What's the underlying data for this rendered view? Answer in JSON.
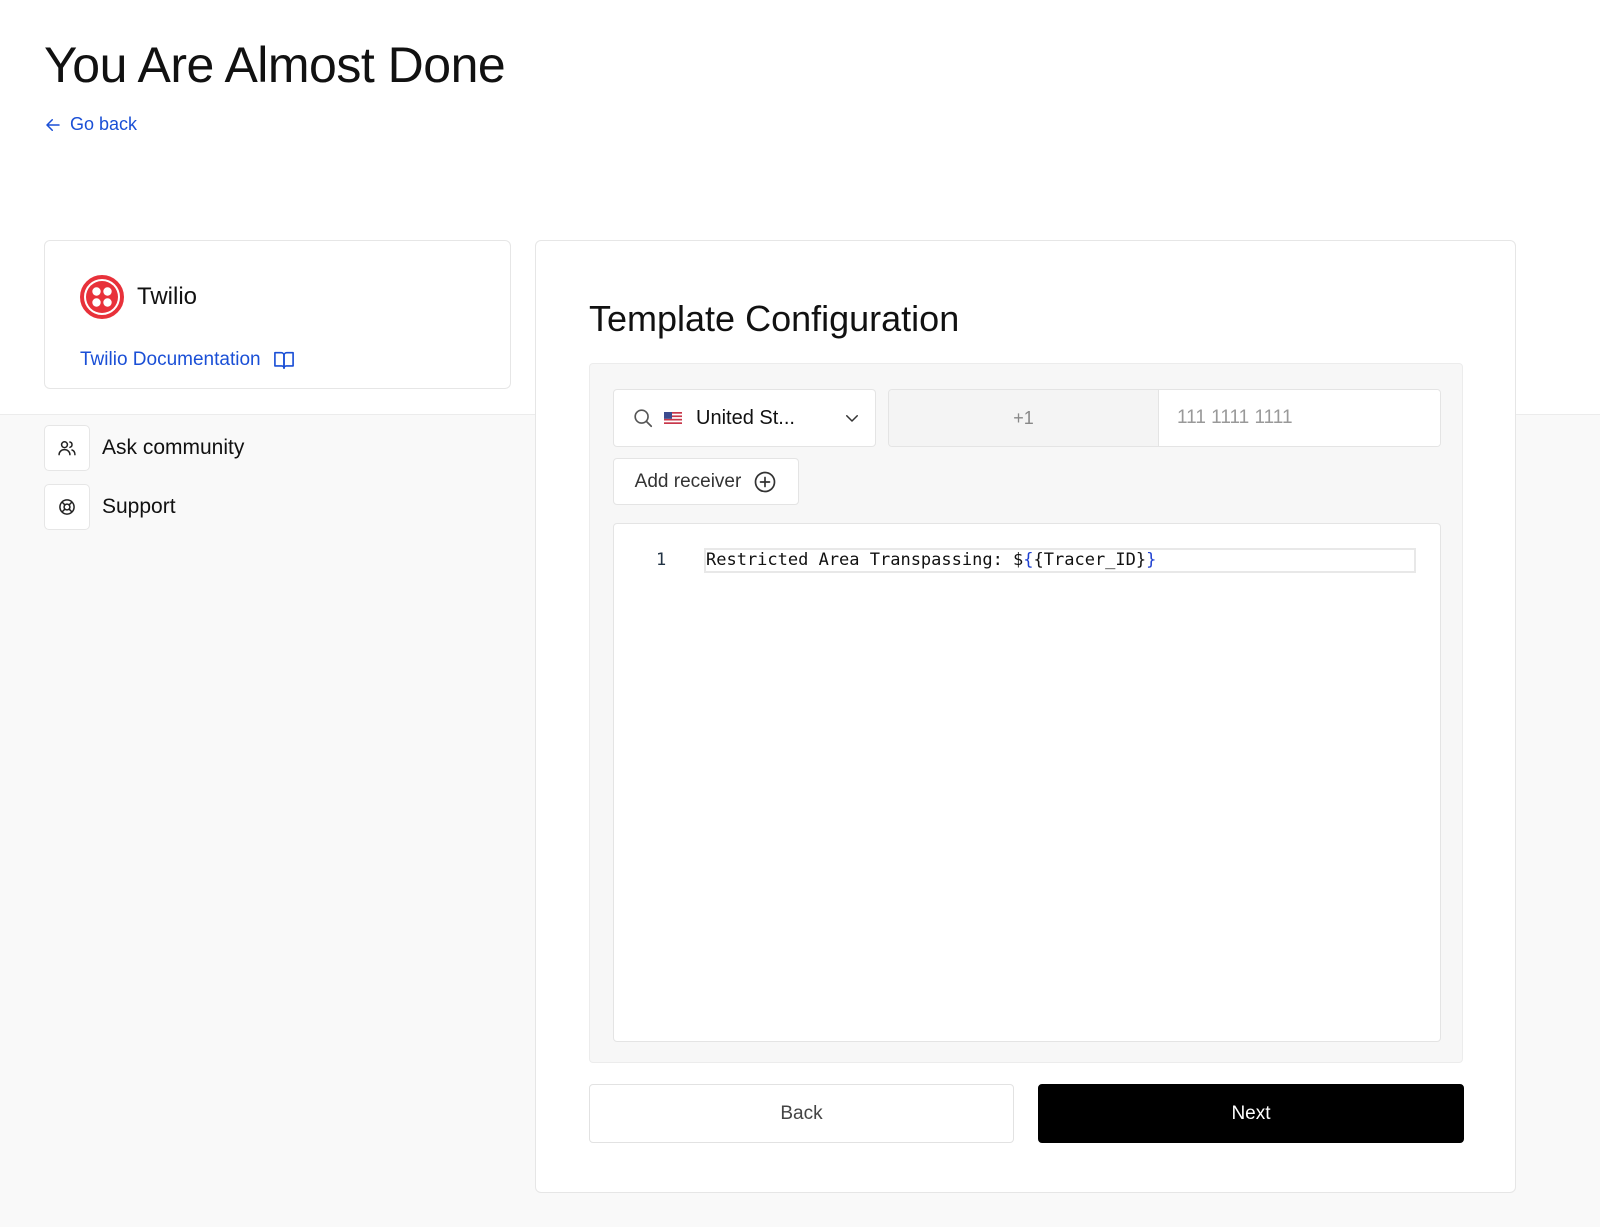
{
  "page": {
    "title": "You Are Almost Done",
    "go_back_label": "Go back"
  },
  "provider": {
    "name": "Twilio",
    "brand_color": "#e8313a",
    "doc_link_label": "Twilio Documentation"
  },
  "sidebar": {
    "items": [
      {
        "label": "Ask community",
        "icon": "users-icon"
      },
      {
        "label": "Support",
        "icon": "lifebuoy-icon"
      }
    ]
  },
  "template_config": {
    "title": "Template Configuration",
    "country_select": {
      "value": "United St...",
      "flag": "us-flag-icon"
    },
    "dial_code": "+1",
    "phone": {
      "value": "",
      "placeholder": "111 1111 1111"
    },
    "add_receiver_label": "Add receiver",
    "editor": {
      "lines": [
        {
          "number": "1",
          "text_prefix": "Restricted Area Transpassing: $",
          "open_brace": "{",
          "var_text": "{Tracer_ID}",
          "close_brace": "}"
        }
      ]
    }
  },
  "actions": {
    "back_label": "Back",
    "next_label": "Next"
  },
  "colors": {
    "link": "#1a4fd6",
    "primary_button": "#000000"
  }
}
